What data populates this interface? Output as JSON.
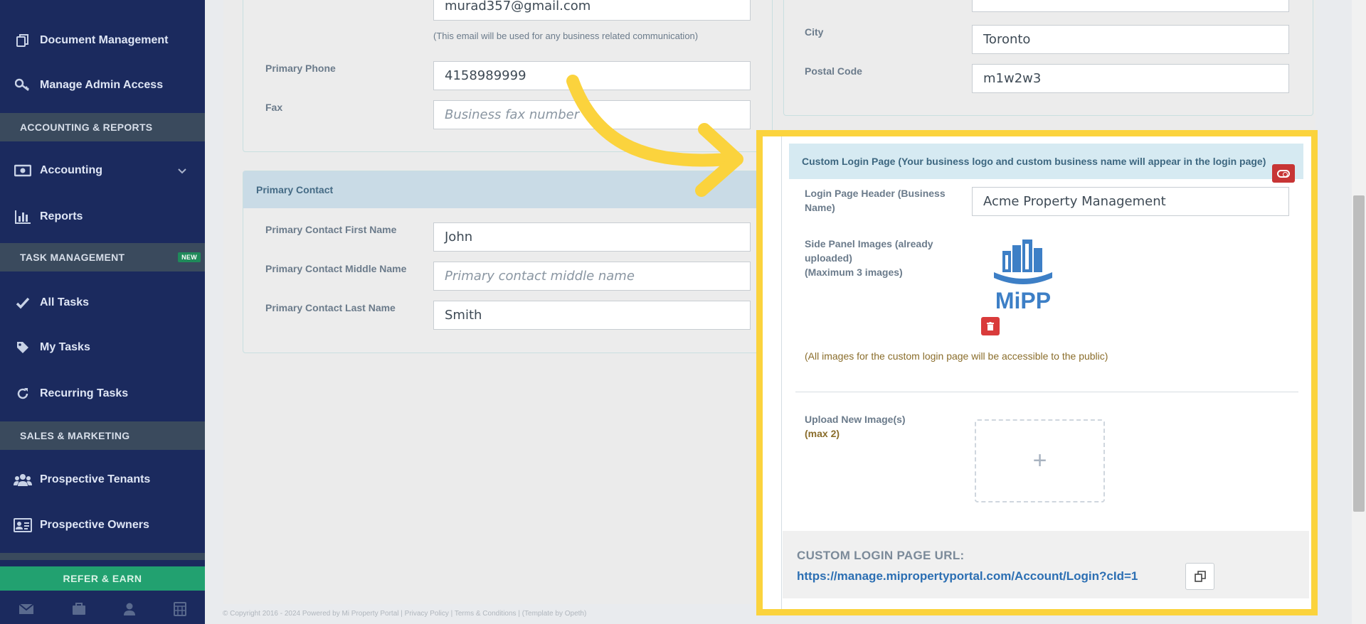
{
  "sidebar": {
    "items": [
      {
        "label": "Document Management",
        "icon": "copy-icon"
      },
      {
        "label": "Manage Admin Access",
        "icon": "key-icon"
      },
      {
        "label": "Accounting",
        "icon": "money-icon"
      },
      {
        "label": "Reports",
        "icon": "bar-chart-icon"
      },
      {
        "label": "All Tasks",
        "icon": "check-icon"
      },
      {
        "label": "My Tasks",
        "icon": "tag-icon"
      },
      {
        "label": "Recurring Tasks",
        "icon": "refresh-icon"
      },
      {
        "label": "Prospective Tenants",
        "icon": "users-icon"
      },
      {
        "label": "Prospective Owners",
        "icon": "id-card-icon"
      }
    ],
    "sections": {
      "accounting": "ACCOUNTING & REPORTS",
      "tasks": "TASK MANAGEMENT",
      "tasks_badge": "NEW",
      "sales": "SALES & MARKETING"
    },
    "refer_label": "REFER & EARN"
  },
  "business": {
    "email_value": "murad357@gmail.com",
    "email_note": "(This email will be used for any business related communication)",
    "phone_label": "Primary Phone",
    "phone_value": "4158989999",
    "fax_label": "Fax",
    "fax_placeholder": "Business fax number"
  },
  "address": {
    "city_label": "City",
    "city_value": "Toronto",
    "postal_label": "Postal Code",
    "postal_value": "m1w2w3"
  },
  "primary_contact": {
    "title": "Primary Contact",
    "first_label": "Primary Contact First Name",
    "first_value": "John",
    "middle_label": "Primary Contact Middle Name",
    "middle_placeholder": "Primary contact middle name",
    "last_label": "Primary Contact Last Name",
    "last_value": "Smith"
  },
  "custom_login": {
    "title": "Custom Login Page (Your business logo and custom business name will appear in the login page)",
    "header_label_1": "Login Page Header (Business",
    "header_label_2": "Name)",
    "header_value": "Acme Property Management",
    "images_label_1": "Side Panel Images (already",
    "images_label_2": "uploaded)",
    "images_label_3": "(Maximum 3 images)",
    "logo_text": "MiPP",
    "public_note": "(All images for the custom login page will be accessible to the public)",
    "upload_label": "Upload New Image(s)",
    "upload_max": "(max 2)",
    "upload_plus": "+",
    "url_label": "CUSTOM LOGIN PAGE URL:",
    "url_value": "https://manage.mipropertyportal.com/Account/Login?cId=1"
  },
  "footer": {
    "text": "© Copyright 2016 - 2024 Powered by Mi Property Portal | Privacy Policy | Terms & Conditions | (Template by Opeth)"
  },
  "colors": {
    "sidebar": "#1b2a5e",
    "highlight": "#fbd33d",
    "accent": "#2c6fb3",
    "danger": "#d93b3b",
    "refer": "#22a170"
  }
}
